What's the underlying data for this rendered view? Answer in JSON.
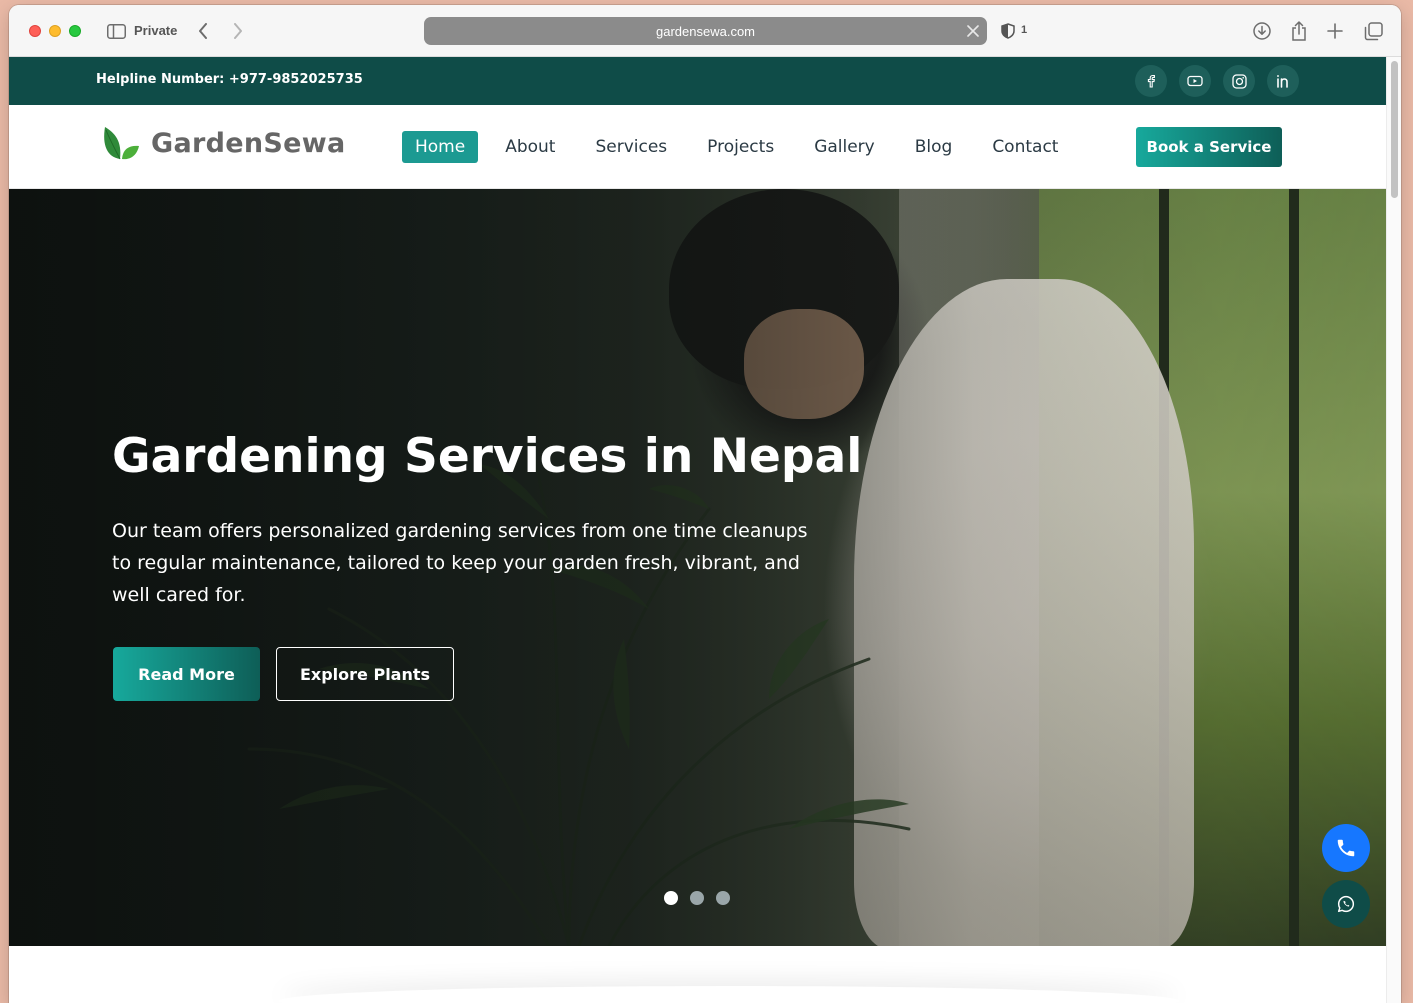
{
  "browser": {
    "private_label": "Private",
    "url": "gardensewa.com",
    "shield_count": "1",
    "icons": [
      "sidebar-icon",
      "back-icon",
      "forward-icon",
      "clear-icon",
      "shield-icon",
      "download-icon",
      "share-icon",
      "plus-icon",
      "tabs-icon"
    ]
  },
  "topbar": {
    "helpline": "Helpline Number: +977-9852025735",
    "social": [
      "facebook-icon",
      "youtube-icon",
      "instagram-icon",
      "linkedin-icon"
    ]
  },
  "header": {
    "logo_text": "GardenSewa",
    "nav": [
      {
        "label": "Home",
        "active": true
      },
      {
        "label": "About"
      },
      {
        "label": "Services"
      },
      {
        "label": "Projects"
      },
      {
        "label": "Gallery"
      },
      {
        "label": "Blog"
      },
      {
        "label": "Contact"
      }
    ],
    "cta": "Book a Service"
  },
  "hero": {
    "title": "Gardening Services in Nepal",
    "text": "Our team offers personalized gardening services from one time cleanups to regular maintenance, tailored to keep your garden fresh, vibrant, and well cared for.",
    "primary_button": "Read More",
    "secondary_button": "Explore Plants",
    "slides": 3,
    "active_slide": 1
  },
  "floating": {
    "call_icon": "phone-icon",
    "whatsapp_icon": "whatsapp-icon"
  },
  "colors": {
    "brand_dark": "#0f4c48",
    "brand_teal": "#1c9a92",
    "call_blue": "#1677ff"
  }
}
